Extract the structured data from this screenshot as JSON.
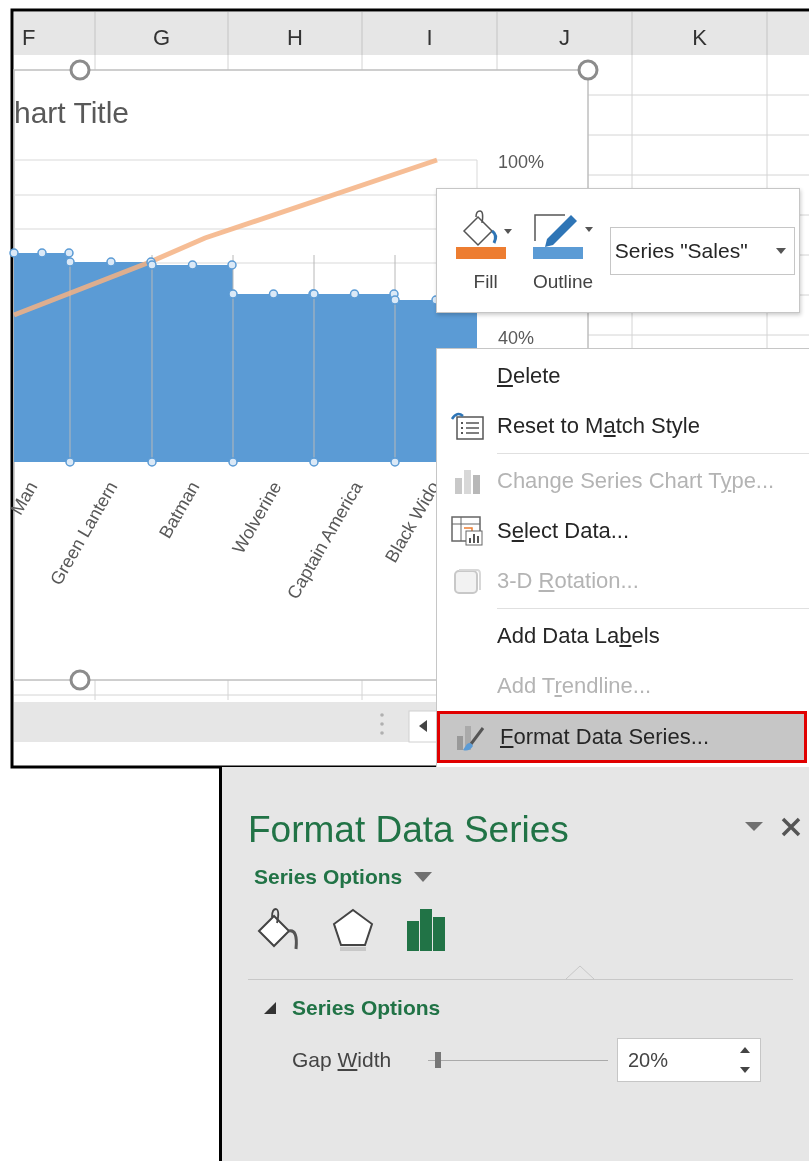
{
  "spreadsheet": {
    "column_headers": [
      "F",
      "G",
      "H",
      "I",
      "J",
      "K"
    ]
  },
  "chart": {
    "title": "hart Title",
    "axis_labels": [
      "Man",
      "Green Lantern",
      "Batman",
      "Wolverine",
      "Captain America",
      "Black Wido"
    ],
    "secondary_axis_labels": [
      "100%",
      "40%"
    ]
  },
  "mini_toolbar": {
    "buttons": [
      {
        "label": "Fill"
      },
      {
        "label": "Outline"
      }
    ],
    "series_dropdown": {
      "value": "Series \"Sales\""
    }
  },
  "context_menu": {
    "items": [
      {
        "key": "D",
        "after": "elete",
        "disabled": false,
        "selected": false,
        "separator_after": false
      },
      {
        "before": "Reset to M",
        "key": "a",
        "after": "tch Style",
        "disabled": false,
        "selected": false,
        "separator_after": true
      },
      {
        "before": "Change Series Chart T",
        "key": "y",
        "after": "pe...",
        "disabled": true,
        "selected": false,
        "separator_after": false
      },
      {
        "before": "S",
        "key": "e",
        "after": "lect Data...",
        "disabled": false,
        "selected": false,
        "separator_after": false
      },
      {
        "before": "3-D ",
        "key": "R",
        "after": "otation...",
        "disabled": true,
        "selected": false,
        "separator_after": true
      },
      {
        "before": "Add Data La",
        "key": "b",
        "after": "els",
        "disabled": false,
        "selected": false,
        "separator_after": false
      },
      {
        "before": "Add T",
        "key": "r",
        "after": "endline...",
        "disabled": true,
        "selected": false,
        "separator_after": false
      },
      {
        "key": "F",
        "after": "ormat Data Series...",
        "disabled": false,
        "selected": true,
        "separator_after": false
      }
    ]
  },
  "format_pane": {
    "title": "Format Data Series",
    "options_menu": "Series Options",
    "tabs": [
      {
        "selected": false
      },
      {
        "selected": false
      },
      {
        "selected": true
      }
    ],
    "section": {
      "title": "Series Options",
      "expanded": true
    },
    "gap_width": {
      "before": "Gap ",
      "key": "W",
      "after": "idth",
      "level": 0.04,
      "value": "20%"
    }
  }
}
